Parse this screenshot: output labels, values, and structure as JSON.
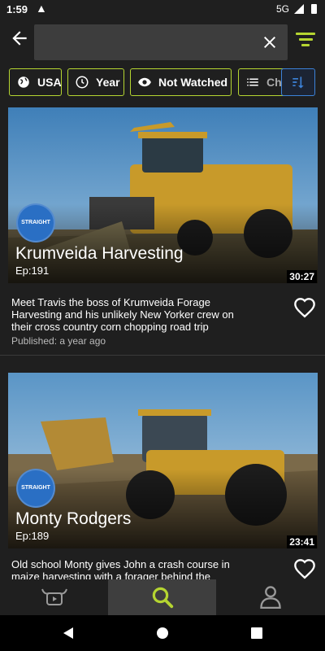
{
  "status": {
    "time": "1:59",
    "network": "5G"
  },
  "search": {
    "value": "",
    "placeholder": ""
  },
  "filters": [
    {
      "label": "USA",
      "icon": "globe-icon"
    },
    {
      "label": "Year",
      "icon": "clock-icon"
    },
    {
      "label": "Not Watched",
      "icon": "eye-icon"
    },
    {
      "label": "Ch",
      "icon": "list-icon"
    }
  ],
  "colors": {
    "accent": "#b5d531",
    "sort": "#3c82d8",
    "background": "#1f1f1f",
    "badge": "#2a6fc4"
  },
  "videos": [
    {
      "title": "Krumveida Harvesting",
      "episode": "Ep:191",
      "duration": "30:27",
      "description": "Meet Travis the boss of Krumveida Forage Harvesting and his unlikely New Yorker crew on their cross country corn chopping road trip",
      "published": "Published: a year ago",
      "badge": "STRAIGHT"
    },
    {
      "title": "Monty Rodgers",
      "episode": "Ep:189",
      "duration": "23:41",
      "description": "Old school Monty gives John a crash course in maize harvesting with a forager behind the",
      "published": "",
      "badge": "STRAIGHT"
    }
  ],
  "nav": [
    {
      "name": "videos",
      "icon": "bull-tv-icon"
    },
    {
      "name": "search",
      "icon": "search-icon"
    },
    {
      "name": "profile",
      "icon": "person-icon"
    }
  ]
}
